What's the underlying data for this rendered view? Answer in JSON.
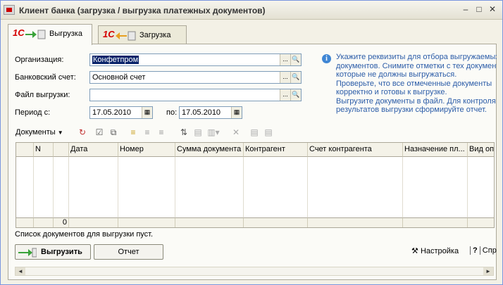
{
  "window": {
    "title": "Клиент банка (загрузка / выгрузка платежных документов)",
    "buttons": [
      "–",
      "□",
      "✕"
    ]
  },
  "tabs": [
    {
      "label": "Выгрузка",
      "active": true
    },
    {
      "label": "Загрузка",
      "active": false
    }
  ],
  "form": {
    "org_label": "Организация:",
    "org_value": "Конфетпром",
    "bank_label": "Банковский счет:",
    "bank_value": "Основной счет",
    "file_label": "Файл выгрузки:",
    "file_value": "",
    "period_label": "Период с:",
    "period_from": "17.05.2010",
    "period_to_label": "по:",
    "period_to": "17.05.2010"
  },
  "info": {
    "text": "Укажите реквизиты для отбора выгружаемых\nдокументов. Снимите отметки с тех документов,\nкоторые не должны выгружаться.\nПроверьте, что все отмеченные документы\nкорректно и готовы к выгрузке.\nВыгрузите документы в файл. Для контроля\nрезультатов выгрузки сформируйте отчет."
  },
  "toolbar": {
    "documents_menu": "Документы"
  },
  "grid": {
    "columns": [
      "",
      "N",
      "",
      "Дата",
      "Номер",
      "Сумма документа",
      "Контрагент",
      "Счет контрагента",
      "Назначение пл...",
      "Вид опе"
    ],
    "footer_count": "0"
  },
  "status": {
    "text": "Список документов для выгрузки пуст."
  },
  "actions": {
    "export_label": "Выгрузить",
    "report_label": "Отчет",
    "settings_label": "Настройка",
    "help_label": "Спр"
  }
}
